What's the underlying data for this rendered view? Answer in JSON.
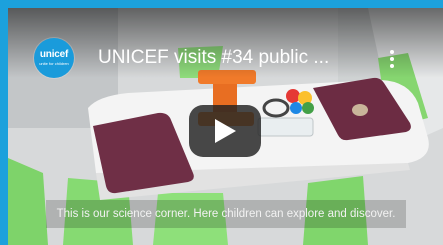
{
  "video": {
    "channel_logo": {
      "brand": "unicef",
      "tagline": "unite for children"
    },
    "title": "UNICEF visits #34 public ...",
    "menu_icon": "more-vert-icon",
    "play_icon": "play-icon",
    "caption": "This is our science corner. Here children can explore and discover.",
    "colors": {
      "border": "#1ca1dc",
      "logo": "#1a9bdb",
      "play_button": "#212121"
    }
  }
}
